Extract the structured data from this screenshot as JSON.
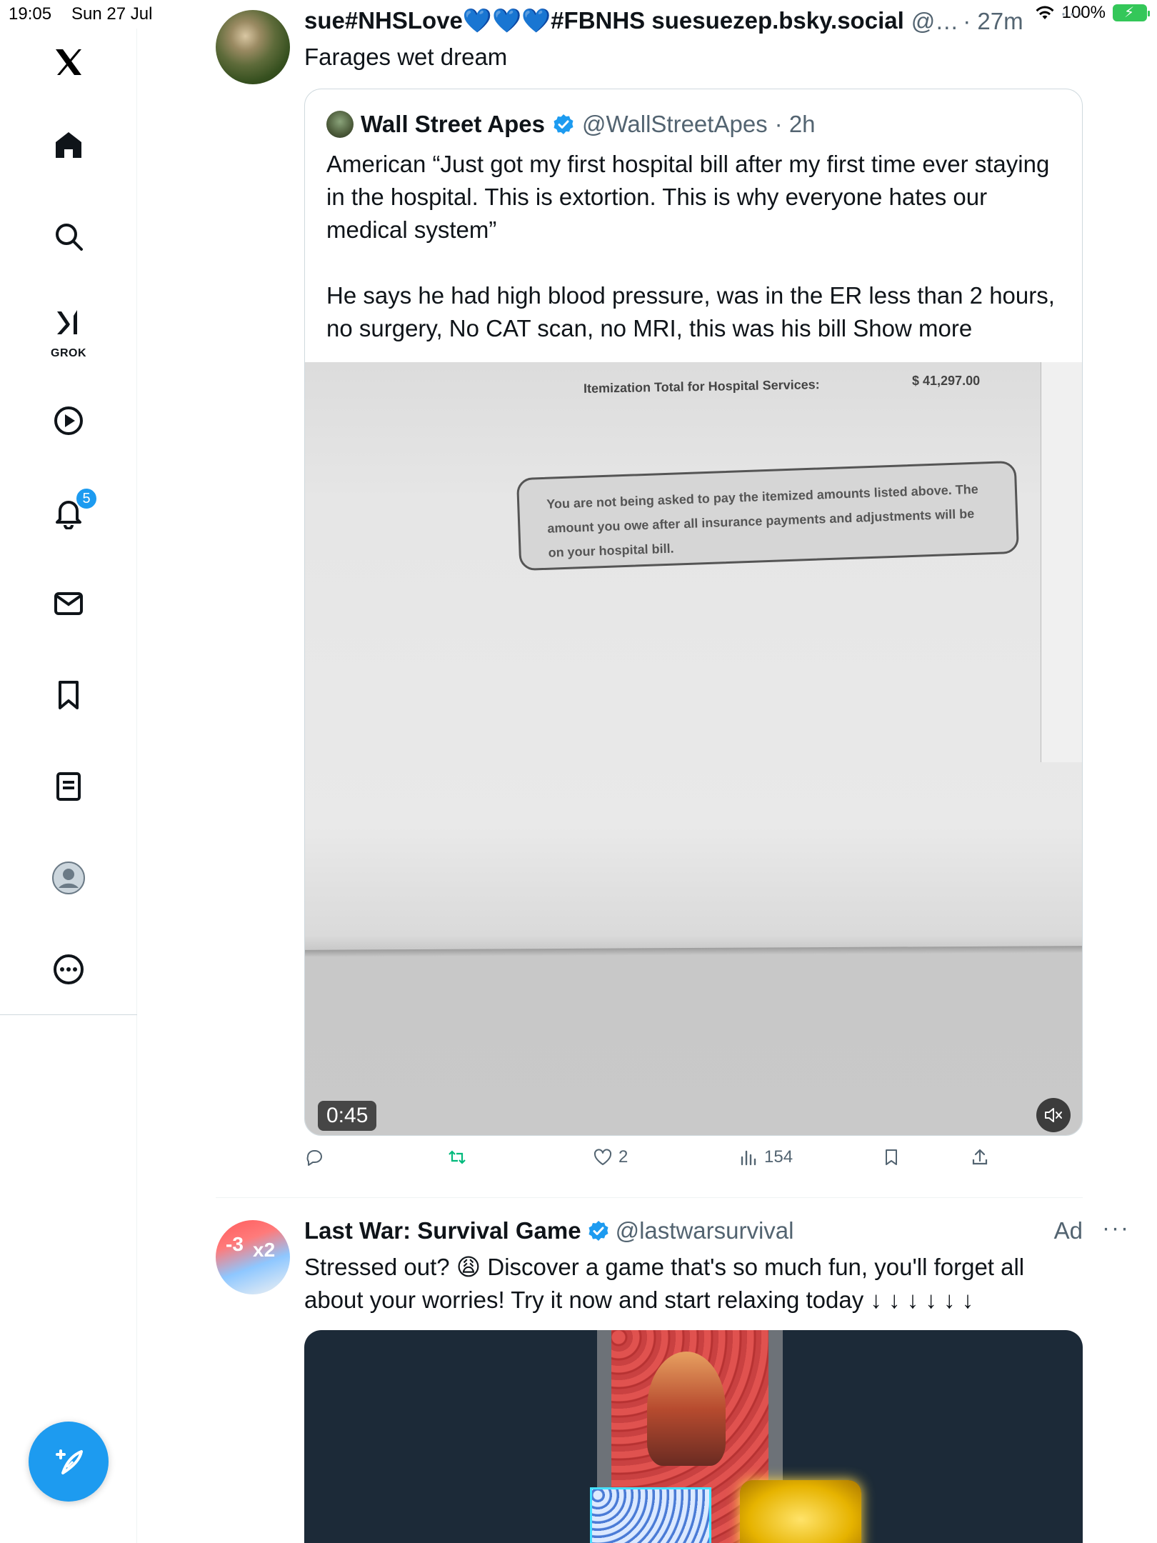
{
  "status_bar": {
    "time": "19:05",
    "date": "Sun 27 Jul",
    "battery": "100%"
  },
  "sidebar": {
    "grok_label": "GROK",
    "notification_count": "5",
    "items": [
      "home-icon",
      "search-icon",
      "grok-icon",
      "video-icon",
      "notifications-icon",
      "messages-icon",
      "bookmarks-icon",
      "lists-icon",
      "profile-icon",
      "more-icon"
    ]
  },
  "tweet1": {
    "display_name": "sue#NHSLove💙💙💙#FBNHS suesuezep.bsky.social",
    "handle": "@…",
    "time": "· 27m",
    "text": "Farages wet dream",
    "quote": {
      "display_name": "Wall Street Apes",
      "handle": "@WallStreetApes",
      "time": "· 2h",
      "paragraph1": "American “Just got my first hospital bill after my first time ever staying in the hospital. This is extortion. This is why everyone hates our medical system”",
      "paragraph2": "He says he had high blood pressure, was in the ER less than 2 hours, no surgery, No CAT scan, no MRI, this was his bill",
      "show_more": "Show more",
      "video": {
        "paper_label": "Itemization Total for Hospital Services:",
        "paper_amount": "$ 41,297.00",
        "paper_notice": "You are not being asked to pay the itemized amounts listed above. The amount you owe after all insurance payments and adjustments will be on your hospital bill.",
        "duration": "0:45"
      }
    },
    "actions": {
      "likes": "2",
      "views": "154"
    }
  },
  "tweet2": {
    "display_name": "Last War: Survival Game",
    "handle": "@lastwarsurvival",
    "ad_label": "Ad",
    "text": "Stressed out? 😩 Discover a game that's so much fun, you'll forget all about your worries! Try it now and start relaxing today ↓ ↓ ↓ ↓ ↓ ↓",
    "avatar_badges": [
      "-3",
      "x2"
    ]
  },
  "colors": {
    "accent": "#1d9bf0",
    "text": "#0f1419",
    "muted": "#536471",
    "retweet": "#00ba7c"
  }
}
